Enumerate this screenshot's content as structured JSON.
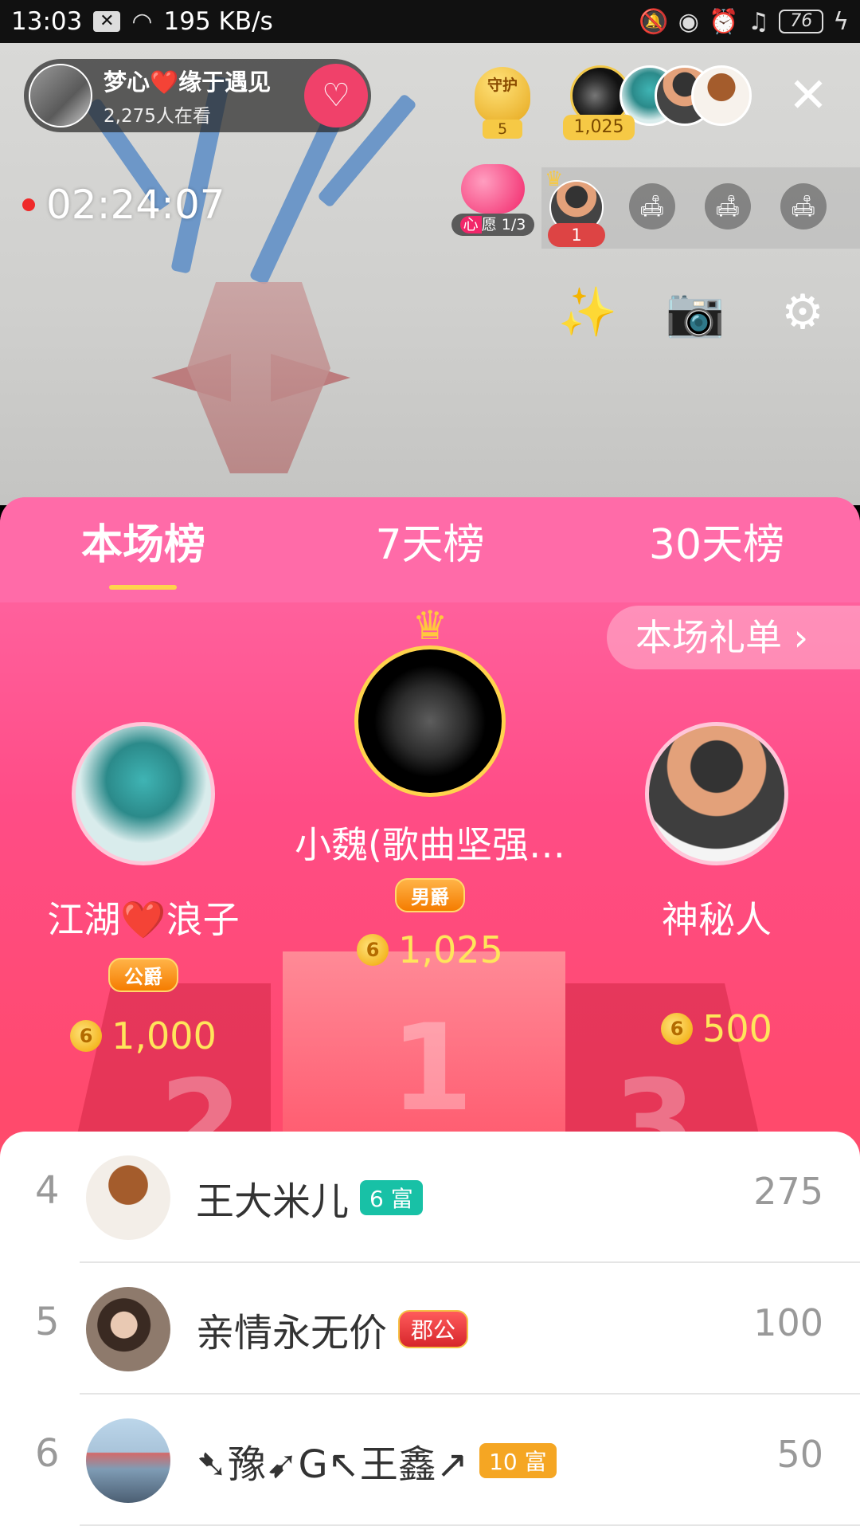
{
  "status_bar": {
    "time": "13:03",
    "network_speed": "195 KB/s",
    "battery": "76"
  },
  "live": {
    "host_name": "梦心❤️缘于遇见",
    "viewers": "2,275人在看",
    "guard_label": "守护",
    "guard_count": "5",
    "top_fan_contribution": "1,025",
    "timer": "02:24:07",
    "wish_label_1": "心",
    "wish_label_2": "愿 1/3",
    "seat_number": "1"
  },
  "tabs": [
    "本场榜",
    "7天榜",
    "30天榜"
  ],
  "gift_list_label": "本场礼单 ›",
  "podium": {
    "first": {
      "name": "小魏(歌曲坚强…",
      "badge": "男爵",
      "coins": "1,025"
    },
    "second": {
      "name": "江湖❤️浪子",
      "badge": "公爵",
      "coins": "1,000"
    },
    "third": {
      "name": "神秘人",
      "coins": "500"
    }
  },
  "rank_list": [
    {
      "rank": "4",
      "name": "王大米儿",
      "tag": "6 富",
      "score": "275"
    },
    {
      "rank": "5",
      "name": "亲情永无价",
      "tag": "郡公",
      "score": "100"
    },
    {
      "rank": "6",
      "name": "➷豫➹G↖王鑫↗",
      "tag": "10 富",
      "score": "50"
    }
  ],
  "colors": {
    "accent_pink": "#ff4c86",
    "coin_yellow": "#ffe55b",
    "tag_teal": "#18c1a6",
    "tag_orange": "#f5a623"
  }
}
